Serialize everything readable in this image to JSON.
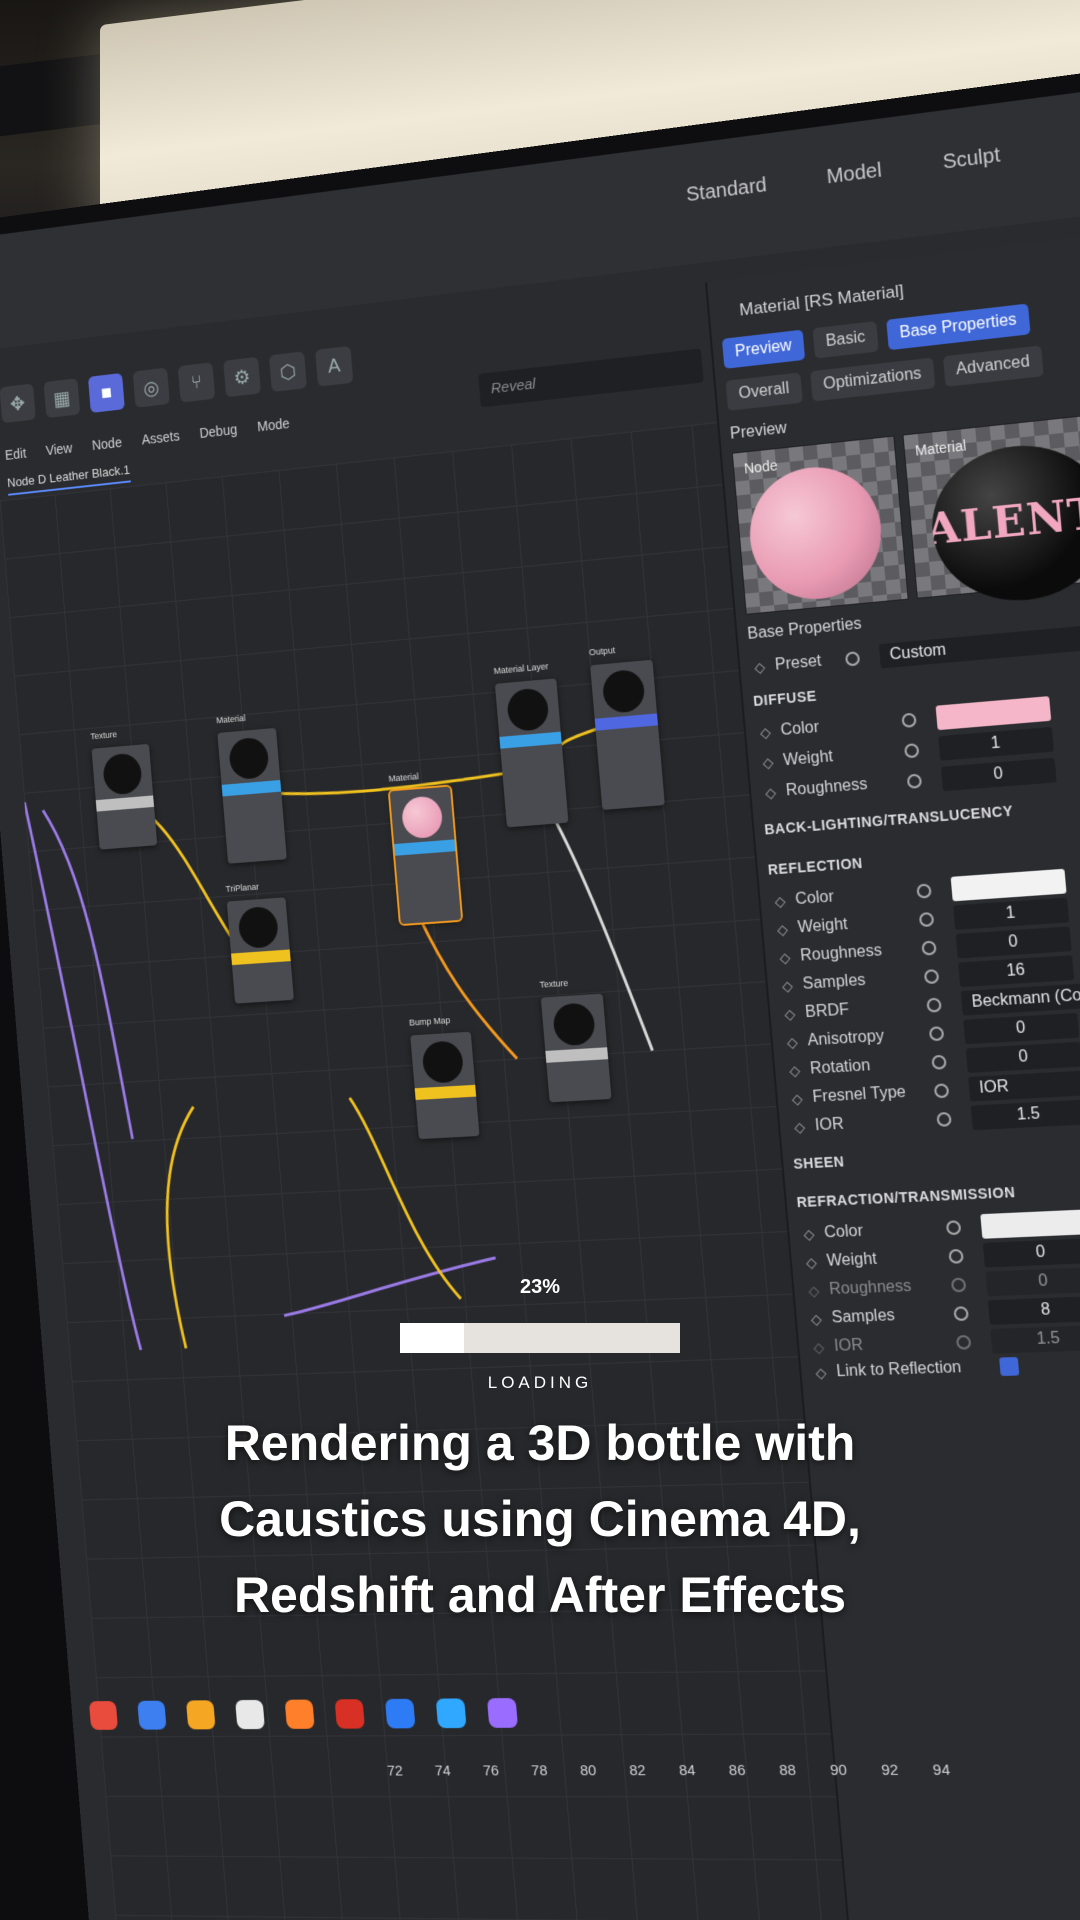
{
  "app": {
    "workspace_tabs": [
      "Standard",
      "Model",
      "Sculpt"
    ],
    "menu": [
      "Edit",
      "View",
      "Node",
      "Assets",
      "Debug",
      "Mode"
    ],
    "node_tab": "Node D Leather Black.1",
    "search_placeholder": "Reveal"
  },
  "graph": {
    "nodes": [
      {
        "label": "Texture",
        "bar": "#bfbfbf",
        "thumb": "#111"
      },
      {
        "label": "Material",
        "bar": "#3aa0e6",
        "thumb": "#111"
      },
      {
        "label": "TriPlanar",
        "bar": "#f0c21f",
        "thumb": "#111"
      },
      {
        "label": "Material",
        "bar": "#3aa0e6",
        "thumb": "#f2a4bf"
      },
      {
        "label": "Material Layer",
        "bar": "#3aa0e6",
        "thumb": "#111"
      },
      {
        "label": "Output",
        "bar": "#4f67e0",
        "thumb": "#111"
      },
      {
        "label": "Bump Map",
        "bar": "#f0c21f",
        "thumb": "#111"
      },
      {
        "label": "Texture",
        "bar": "#bfbfbf",
        "thumb": "#111"
      }
    ]
  },
  "panel": {
    "title": "Material [RS Material]",
    "tabs": [
      "Preview",
      "Basic",
      "Base Properties"
    ],
    "tabs2": [
      "Overall",
      "Optimizations",
      "Advanced"
    ],
    "preview_heading": "Preview",
    "preview_node_label": "Node",
    "preview_material_label": "Material",
    "preview_logo": "ALENTIN",
    "base_properties": "Base Properties",
    "preset_label": "Preset",
    "preset_value": "Custom",
    "diffuse": {
      "heading": "DIFFUSE",
      "color_label": "Color",
      "color": "#f4b6c8",
      "weight_label": "Weight",
      "weight": "1",
      "roughness_label": "Roughness",
      "roughness": "0"
    },
    "backlighting_heading": "BACK-LIGHTING/TRANSLUCENCY",
    "reflection": {
      "heading": "REFLECTION",
      "color_label": "Color",
      "color": "#f2f2f2",
      "weight_label": "Weight",
      "weight": "1",
      "roughness_label": "Roughness",
      "roughness": "0",
      "samples_label": "Samples",
      "samples": "16",
      "brdf_label": "BRDF",
      "brdf": "Beckmann (Cook-Torra",
      "anisotropy_label": "Anisotropy",
      "anisotropy": "0",
      "rotation_label": "Rotation",
      "rotation": "0",
      "fresnel_label": "Fresnel Type",
      "fresnel": "IOR",
      "ior_label": "IOR",
      "ior": "1.5"
    },
    "sheen_heading": "SHEEN",
    "refraction": {
      "heading": "REFRACTION/TRANSMISSION",
      "color_label": "Color",
      "weight_label": "Weight",
      "weight": "0",
      "roughness_label": "Roughness",
      "roughness": "0",
      "samples_label": "Samples",
      "samples": "8",
      "ior_label": "IOR",
      "ior": "1.5",
      "link_label": "Link to Reflection"
    }
  },
  "timeline_ticks": [
    "72",
    "74",
    "76",
    "78",
    "80",
    "82",
    "84",
    "86",
    "88",
    "90",
    "92",
    "94"
  ],
  "overlay": {
    "percent_text": "23%",
    "progress": 0.23,
    "loading_text": "LOADING",
    "headline_1": "Rendering a 3D bottle with",
    "headline_2": "Caustics using Cinema 4D,",
    "headline_3": "Redshift and After Effects"
  },
  "colors": {
    "accent_blue": "#3f67d8",
    "wire_yellow": "#f0c21f",
    "wire_purple": "#9b7be8",
    "selection_orange": "#f39a1e"
  }
}
